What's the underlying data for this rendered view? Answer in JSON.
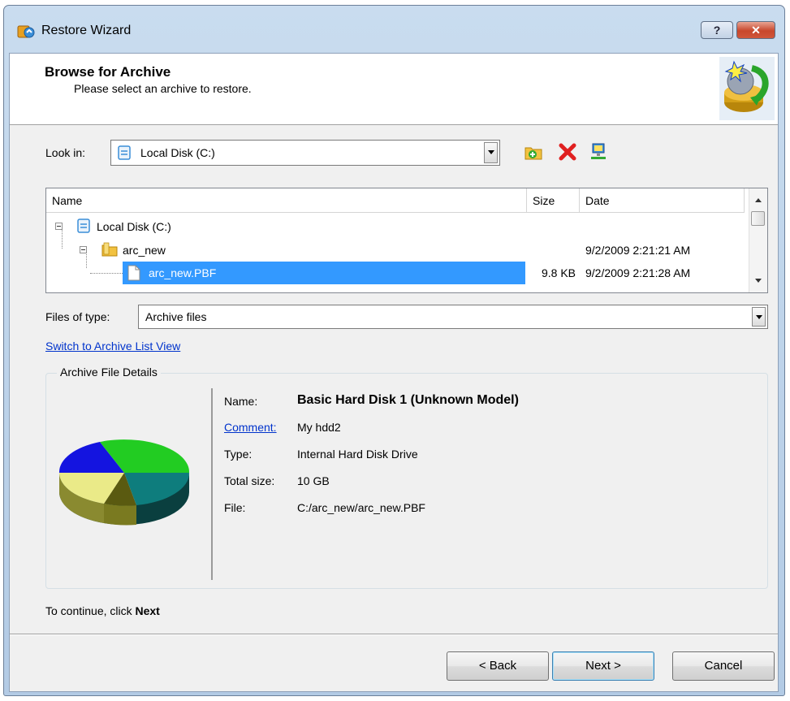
{
  "window": {
    "title": "Restore Wizard",
    "help_label": "?",
    "close_label": "✕"
  },
  "header": {
    "title": "Browse for Archive",
    "subtitle": "Please select an archive to restore."
  },
  "look_in": {
    "label": "Look in:",
    "value": "Local Disk (C:)"
  },
  "file_list": {
    "columns": [
      "Name",
      "Size",
      "Date"
    ],
    "rows": [
      {
        "name": "Local Disk (C:)",
        "size": "",
        "date": ""
      },
      {
        "name": "arc_new",
        "size": "",
        "date": "9/2/2009 2:21:21 AM"
      },
      {
        "name": "arc_new.PBF",
        "size": "9.8 KB",
        "date": "9/2/2009 2:21:28 AM"
      }
    ]
  },
  "files_of_type": {
    "label": "Files of type:",
    "value": "Archive files"
  },
  "switch_link": "Switch to Archive List View",
  "details": {
    "group_title": "Archive File Details",
    "name_label": "Name:",
    "name_value": "Basic Hard Disk 1 (Unknown Model)",
    "comment_label": "Comment:",
    "comment_value": "My hdd2",
    "type_label": "Type:",
    "type_value": "Internal Hard Disk Drive",
    "size_label": "Total size:",
    "size_value": "10 GB",
    "file_label": "File:",
    "file_value": "C:/arc_new/arc_new.PBF"
  },
  "hint": {
    "text": "To continue, click ",
    "bold": "Next"
  },
  "buttons": {
    "back": "< Back",
    "next": "Next >",
    "cancel": "Cancel"
  },
  "colors": {
    "selection": "#3399ff",
    "link": "#0033cc",
    "pie_green": "#22cc22",
    "pie_teal": "#0e7d7d",
    "pie_yellow": "#eaea88",
    "pie_blue": "#1414e0"
  }
}
